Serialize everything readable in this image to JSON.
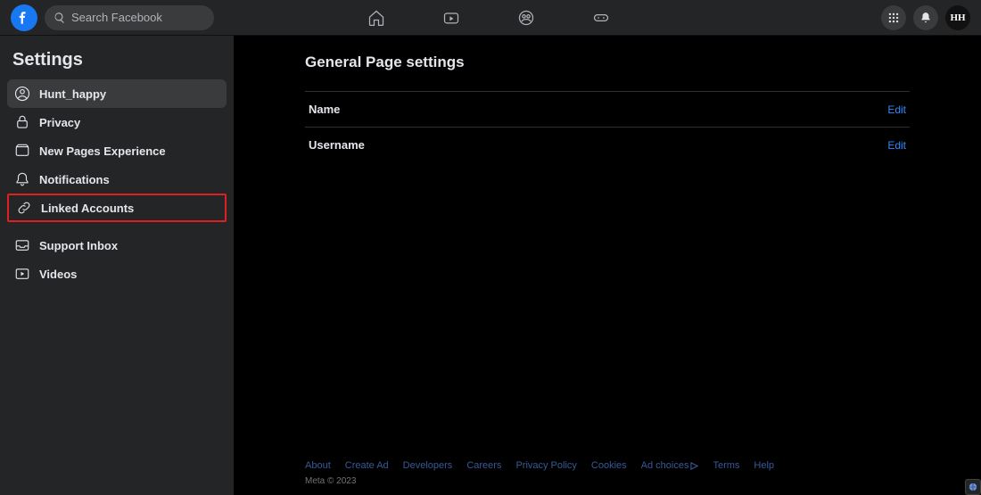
{
  "search": {
    "placeholder": "Search Facebook"
  },
  "avatar": {
    "text": "HH"
  },
  "sidebar": {
    "title": "Settings",
    "items": [
      {
        "label": "Hunt_happy"
      },
      {
        "label": "Privacy"
      },
      {
        "label": "New Pages Experience"
      },
      {
        "label": "Notifications"
      },
      {
        "label": "Linked Accounts"
      },
      {
        "label": "Support Inbox"
      },
      {
        "label": "Videos"
      }
    ]
  },
  "main": {
    "title": "General Page settings",
    "rows": [
      {
        "label": "Name",
        "action": "Edit"
      },
      {
        "label": "Username",
        "action": "Edit"
      }
    ]
  },
  "footer": {
    "links": [
      "About",
      "Create Ad",
      "Developers",
      "Careers",
      "Privacy Policy",
      "Cookies",
      "Ad choices",
      "Terms",
      "Help"
    ],
    "copyright": "Meta © 2023"
  }
}
